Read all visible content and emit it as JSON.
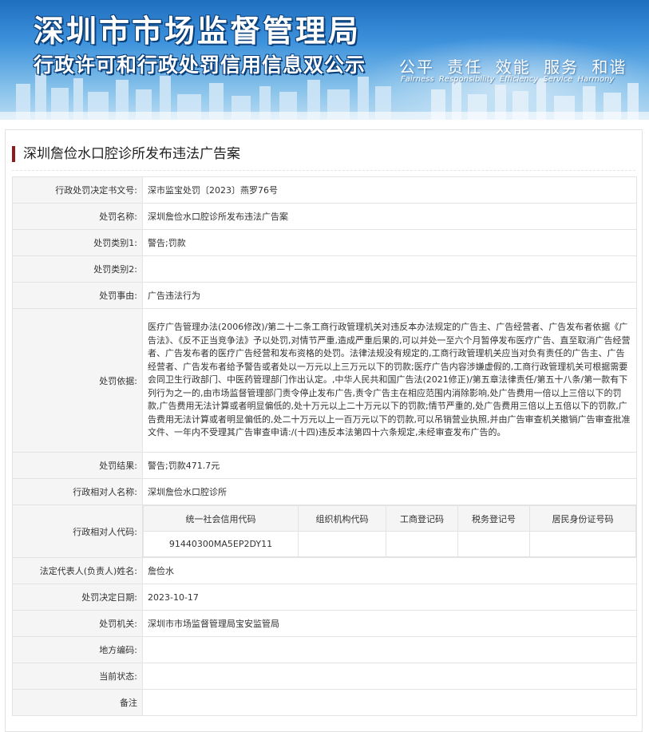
{
  "header": {
    "title": "深圳市市场监督管理局",
    "subtitle": "行政许可和行政处罚信用信息双公示",
    "slogan_cn": "公平  责任  效能  服务  和谐",
    "slogan_en": "Fairness Responsibility Efficiency Service Harmony"
  },
  "case": {
    "title": "深圳詹俭水口腔诊所发布违法广告案",
    "accent_color": "#8b1c1c"
  },
  "rows": {
    "decision_no": {
      "label": "行政处罚决定书文号:",
      "value": "深市监宝处罚〔2023〕燕罗76号"
    },
    "name": {
      "label": "处罚名称:",
      "value": "深圳詹俭水口腔诊所发布违法广告案"
    },
    "category1": {
      "label": "处罚类别1:",
      "value": "警告;罚款"
    },
    "category2": {
      "label": "处罚类别2:",
      "value": ""
    },
    "reason": {
      "label": "处罚事由:",
      "value": "广告违法行为"
    },
    "basis": {
      "label": "处罚依据:",
      "value": "医疗广告管理办法(2006修改)/第二十二条工商行政管理机关对违反本办法规定的广告主、广告经营者、广告发布者依据《广告法》、《反不正当竞争法》予以处罚,对情节严重,造成严重后果的,可以并处一至六个月暂停发布医疗广告、直至取消广告经营者、广告发布者的医疗广告经营和发布资格的处罚。法律法规没有规定的,工商行政管理机关应当对负有责任的广告主、广告经营者、广告发布者给予警告或者处以一万元以上三万元以下的罚款;医疗广告内容涉嫌虚假的,工商行政管理机关可根据需要会同卫生行政部门、中医药管理部门作出认定。,中华人民共和国广告法(2021修正)/第五章法律责任/第五十八条/第一款有下列行为之一的,由市场监督管理部门责令停止发布广告,责令广告主在相应范围内消除影响,处广告费用一倍以上三倍以下的罚款,广告费用无法计算或者明显偏低的,处十万元以上二十万元以下的罚款;情节严重的,处广告费用三倍以上五倍以下的罚款,广告费用无法计算或者明显偏低的,处二十万元以上一百万元以下的罚款,可以吊销营业执照,并由广告审查机关撤销广告审查批准文件、一年内不受理其广告审查申请:/(十四)违反本法第四十六条规定,未经审查发布广告的。"
    },
    "result": {
      "label": "处罚结果:",
      "value": "警告;罚款471.7元"
    },
    "party_name": {
      "label": "行政相对人名称:",
      "value": "深圳詹俭水口腔诊所"
    },
    "party_code": {
      "label": "行政相对人代码:",
      "headers": [
        "统一社会信用代码",
        "组织机构代码",
        "工商登记码",
        "税务登记号",
        "居民身份证号码"
      ],
      "values": [
        "91440300MA5EP2DY11",
        "",
        "",
        "",
        ""
      ]
    },
    "legal_rep": {
      "label": "法定代表人(负责人)姓名:",
      "value": "詹俭水"
    },
    "date": {
      "label": "处罚决定日期:",
      "value": "2023-10-17"
    },
    "authority": {
      "label": "处罚机关:",
      "value": "深圳市市场监督管理局宝安监管局"
    },
    "region_code": {
      "label": "地方编码:",
      "value": ""
    },
    "status": {
      "label": "当前状态:",
      "value": ""
    },
    "remark": {
      "label": "备注",
      "value": ""
    }
  }
}
